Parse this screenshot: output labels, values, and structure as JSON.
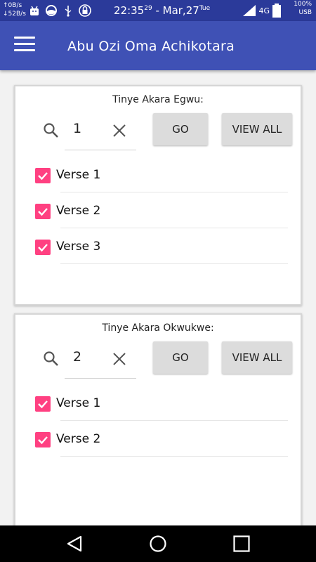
{
  "status": {
    "net_up": "↑0B/s",
    "net_down": "↓52B/s",
    "time": "22:35",
    "seconds": "29",
    "date": " - Mar,27",
    "day": "Tue",
    "network": "4G",
    "battery": "100%",
    "usb": "USB"
  },
  "appbar": {
    "title": "Abu Ozi Oma Achikotara",
    "menu_icon": "hamburger-menu-icon"
  },
  "cards": [
    {
      "label": "Tinye Akara Egwu:",
      "number": "1",
      "go": "GO",
      "view_all": "VIEW ALL",
      "verses": [
        "Verse 1",
        "Verse 2",
        "Verse 3"
      ]
    },
    {
      "label": "Tinye Akara Okwukwe:",
      "number": "2",
      "go": "GO",
      "view_all": "VIEW ALL",
      "verses": [
        "Verse 1",
        "Verse 2"
      ]
    }
  ],
  "colors": {
    "status_bar": "#2b3a9a",
    "app_bar": "#3f51b5",
    "checkbox": "#ff4081"
  }
}
